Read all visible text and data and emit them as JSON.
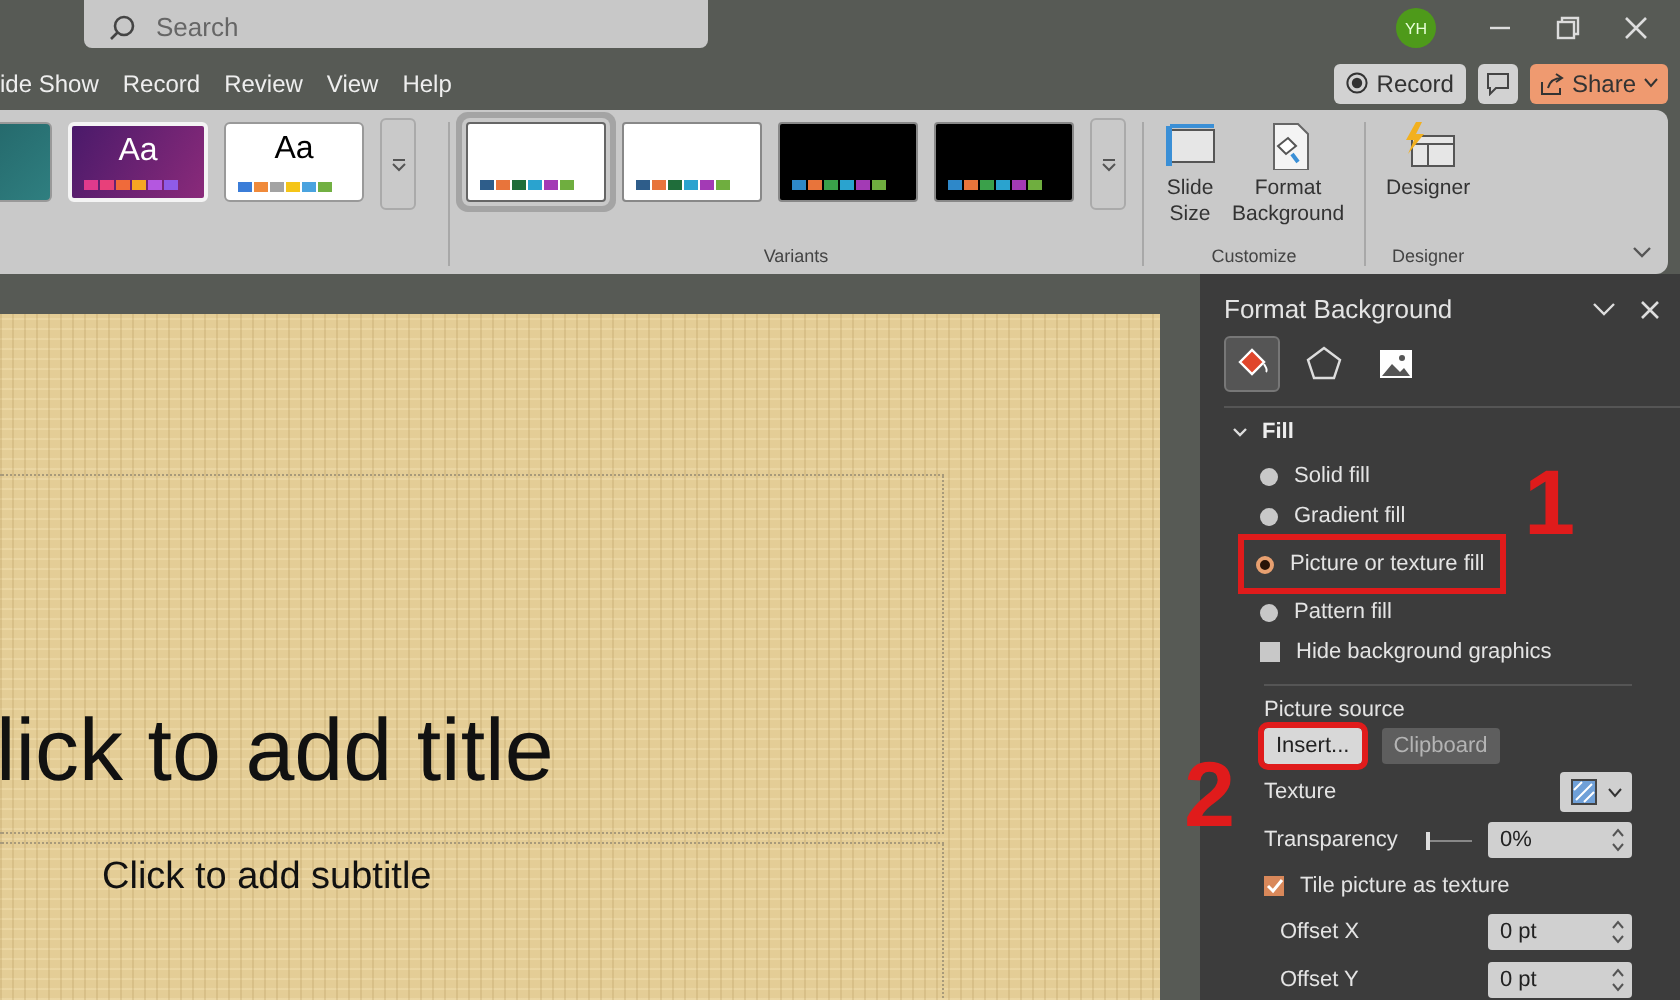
{
  "title_bar": {
    "search": {
      "placeholder": "Search"
    },
    "avatar": "YH"
  },
  "ribbon_tabs": [
    {
      "label": "ide Show",
      "selected": false
    },
    {
      "label": "Record",
      "selected": false
    },
    {
      "label": "Review",
      "selected": false
    },
    {
      "label": "View",
      "selected": false
    },
    {
      "label": "Help",
      "selected": false
    }
  ],
  "actions": {
    "record": "Record",
    "share": "Share"
  },
  "ribbon": {
    "themes": [
      {
        "kind": "teal",
        "selected": false
      },
      {
        "kind": "purple",
        "label": "Aa",
        "selected": true
      },
      {
        "kind": "white",
        "label": "Aa",
        "selected": false
      }
    ],
    "variants": {
      "label": "Variants",
      "items": [
        {
          "kind": "light",
          "selected": true
        },
        {
          "kind": "light",
          "selected": false
        },
        {
          "kind": "dark",
          "selected": false
        },
        {
          "kind": "dark",
          "selected": false
        }
      ]
    },
    "customize": {
      "label": "Customize",
      "buttons": [
        {
          "kind": "slide-size",
          "lines": [
            "Slide",
            "Size"
          ]
        },
        {
          "kind": "format-background",
          "lines": [
            "Format",
            "Background"
          ]
        }
      ]
    },
    "designer": {
      "label": "Designer",
      "button": "Designer"
    }
  },
  "slide": {
    "title": "lick to add title",
    "subtitle": "Click to add subtitle"
  },
  "format_pane": {
    "title": "Format Background",
    "tabs": [
      {
        "kind": "fill",
        "selected": true
      },
      {
        "kind": "effects",
        "selected": false
      },
      {
        "kind": "picture",
        "selected": false
      }
    ],
    "section": {
      "label": "Fill",
      "expanded": true
    },
    "fill_options": [
      {
        "label": "Solid fill",
        "selected": false,
        "highlighted": false
      },
      {
        "label": "Gradient fill",
        "selected": false,
        "highlighted": false
      },
      {
        "label": "Picture or texture fill",
        "selected": true,
        "highlighted": true
      },
      {
        "label": "Pattern fill",
        "selected": false,
        "highlighted": false
      }
    ],
    "hide_graphics": {
      "label": "Hide background graphics",
      "checked": false
    },
    "picture_source": {
      "label": "Picture source",
      "buttons": [
        {
          "label": "Insert...",
          "disabled": false,
          "highlighted": true
        },
        {
          "label": "Clipboard",
          "disabled": true,
          "highlighted": false
        }
      ]
    },
    "texture": {
      "label": "Texture"
    },
    "transparency": {
      "label": "Transparency",
      "level": 0,
      "value": "0%"
    },
    "tile": {
      "label": "Tile picture as texture",
      "checked": true
    },
    "offsets": [
      {
        "label": "Offset X",
        "value": "0 pt"
      },
      {
        "label": "Offset Y",
        "value": "0 pt"
      }
    ]
  },
  "annotations": [
    {
      "label": "1"
    },
    {
      "label": "2"
    }
  ]
}
